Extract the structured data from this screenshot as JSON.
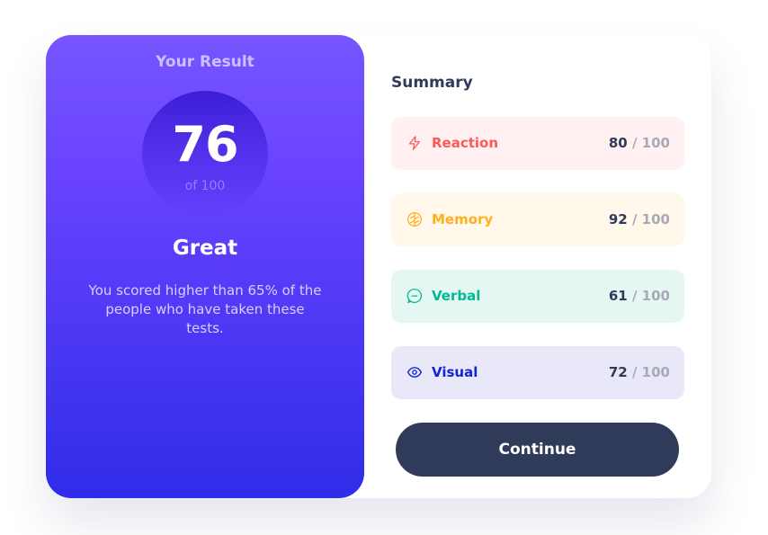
{
  "result": {
    "title": "Your Result",
    "score": "76",
    "score_max": "of 100",
    "rating": "Great",
    "description": "You scored higher than 65% of the people who have taken these tests."
  },
  "summary": {
    "title": "Summary",
    "items": [
      {
        "label": "Reaction",
        "score": "80",
        "max": "/ 100",
        "icon": "lightning-icon",
        "color": "#ff5757",
        "bg": "#fff1f1"
      },
      {
        "label": "Memory",
        "score": "92",
        "max": "/ 100",
        "icon": "brain-icon",
        "color": "#ffb01f",
        "bg": "#fff8eb"
      },
      {
        "label": "Verbal",
        "score": "61",
        "max": "/ 100",
        "icon": "chat-bubble-icon",
        "color": "#00bb8f",
        "bg": "#e6f7f3"
      },
      {
        "label": "Visual",
        "score": "72",
        "max": "/ 100",
        "icon": "eye-icon",
        "color": "#1125d6",
        "bg": "#e8e8f9"
      }
    ]
  },
  "actions": {
    "continue_label": "Continue"
  },
  "colors": {
    "gradient_top": "#7755ff",
    "gradient_bottom": "#2f2ce9",
    "dark_navy": "#303b5a"
  }
}
